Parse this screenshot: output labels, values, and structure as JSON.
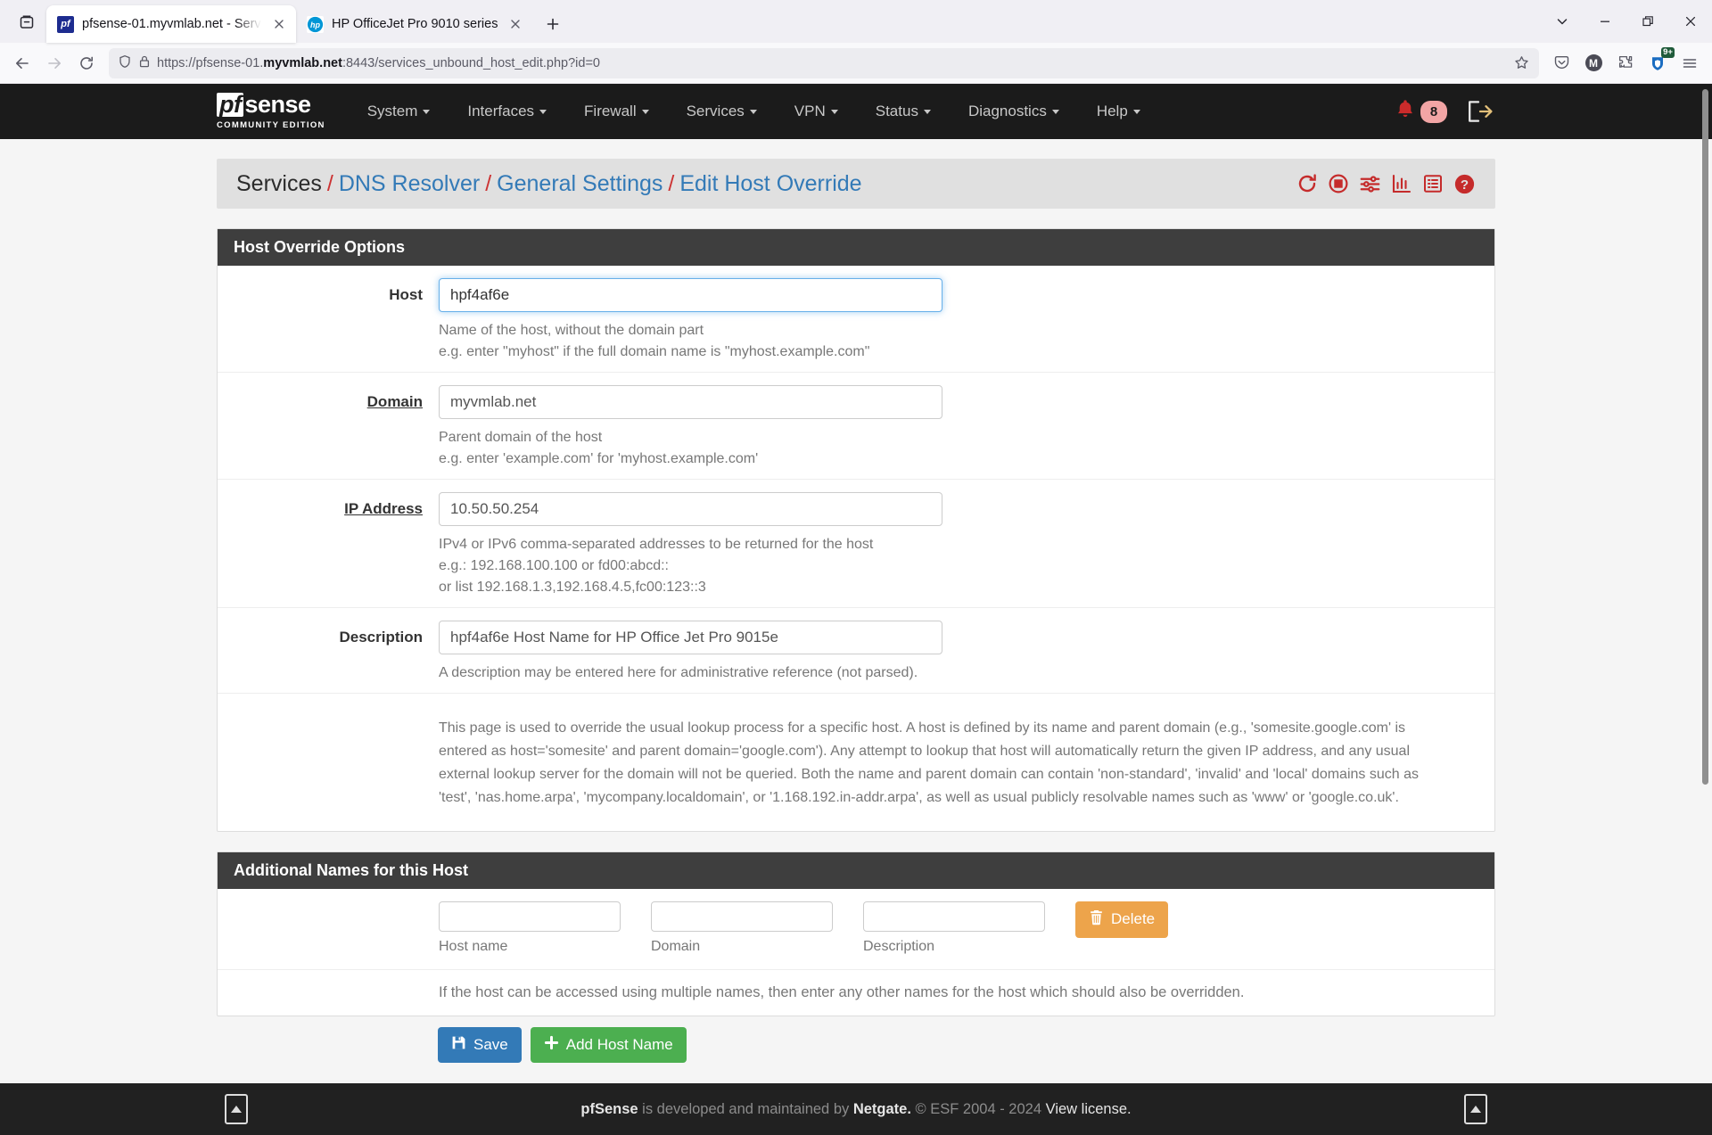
{
  "browser": {
    "tabs": [
      {
        "title": "pfsense-01.myvmlab.net - Servi",
        "favicon": "pfsense-icon",
        "active": true
      },
      {
        "title": "HP OfficeJet Pro 9010 series",
        "favicon": "hp-icon",
        "active": false
      }
    ],
    "url_prefix": "https://pfsense-01.",
    "url_bold": "myvmlab.net",
    "url_suffix": ":8443/services_unbound_host_edit.php?id=0",
    "extension_badge": "9+",
    "account_initial": "M",
    "icons": {
      "list_all_tabs": "chevron-down-icon",
      "new_tab": "plus-icon",
      "minimize": "minimize-icon",
      "restore": "restore-icon",
      "close_window": "close-icon",
      "back": "back-arrow-icon",
      "forward": "forward-arrow-icon",
      "reload": "reload-icon",
      "shield": "shield-icon",
      "lock": "padlock-icon",
      "bookmark": "star-icon",
      "pocket": "pocket-icon",
      "extensions": "puzzle-piece-icon",
      "menu": "hamburger-menu-icon",
      "firefox_view": "firefox-view-icon"
    }
  },
  "pfsense": {
    "logo": {
      "pf": "pf",
      "sense": "sense",
      "edition": "COMMUNITY EDITION"
    },
    "menu": [
      "System",
      "Interfaces",
      "Firewall",
      "Services",
      "VPN",
      "Status",
      "Diagnostics",
      "Help"
    ],
    "alert_count": "8",
    "alert_icon": "bell-icon",
    "logout_icon": "logout-icon",
    "breadcrumb": {
      "root": "Services",
      "links": [
        "DNS Resolver",
        "General Settings",
        "Edit Host Override"
      ],
      "separator": "/"
    },
    "crumb_icons": [
      "restart-service-icon",
      "stop-service-icon",
      "filter-sliders-icon",
      "bar-chart-icon",
      "list-icon",
      "help-question-icon"
    ],
    "host_override": {
      "panel_title": "Host Override Options",
      "fields": [
        {
          "label": "Host",
          "required": false,
          "value": "hpf4af6e",
          "focused": true,
          "help": [
            "Name of the host, without the domain part",
            "e.g. enter \"myhost\" if the full domain name is \"myhost.example.com\""
          ]
        },
        {
          "label": "Domain",
          "required": true,
          "value": "myvmlab.net",
          "focused": false,
          "help": [
            "Parent domain of the host",
            "e.g. enter 'example.com' for 'myhost.example.com'"
          ]
        },
        {
          "label": "IP Address",
          "required": true,
          "value": "10.50.50.254",
          "focused": false,
          "help": [
            "IPv4 or IPv6 comma-separated addresses to be returned for the host",
            "e.g.: 192.168.100.100 or fd00:abcd::",
            "or list 192.168.1.3,192.168.4.5,fc00:123::3"
          ]
        },
        {
          "label": "Description",
          "required": false,
          "value": "hpf4af6e Host Name for HP Office Jet Pro 9015e",
          "focused": false,
          "help": [
            "A description may be entered here for administrative reference (not parsed)."
          ]
        }
      ],
      "explanation": "This page is used to override the usual lookup process for a specific host. A host is defined by its name and parent domain (e.g., 'somesite.google.com' is entered as host='somesite' and parent domain='google.com'). Any attempt to lookup that host will automatically return the given IP address, and any usual external lookup server for the domain will not be queried. Both the name and parent domain can contain 'non-standard', 'invalid' and 'local' domains such as 'test', 'nas.home.arpa', 'mycompany.localdomain', or '1.168.192.in-addr.arpa', as well as usual publicly resolvable names such as 'www' or 'google.co.uk'."
    },
    "additional_names": {
      "panel_title": "Additional Names for this Host",
      "columns": [
        {
          "label": "Host name",
          "value": ""
        },
        {
          "label": "Domain",
          "value": ""
        },
        {
          "label": "Description",
          "value": ""
        }
      ],
      "delete_label": "Delete",
      "delete_icon": "trash-icon",
      "note": "If the host can be accessed using multiple names, then enter any other names for the host which should also be overridden."
    },
    "actions": {
      "save_label": "Save",
      "save_icon": "save-floppy-icon",
      "add_label": "Add Host Name",
      "add_icon": "plus-icon"
    },
    "footer": {
      "brand": "pfSense",
      "text_mid": " is developed and maintained by ",
      "company": "Netgate.",
      "copyright": " © ESF 2004 - 2024 ",
      "license": "View license.",
      "scroll_icon": "scroll-top-icon"
    },
    "colors": {
      "accent_blue": "#337ab7",
      "accent_green": "#4caf50",
      "accent_orange": "#eda44b",
      "accent_red": "#c52b2b",
      "nav_dark": "#1b1b1b",
      "panel_head": "#3e3e3e"
    }
  }
}
